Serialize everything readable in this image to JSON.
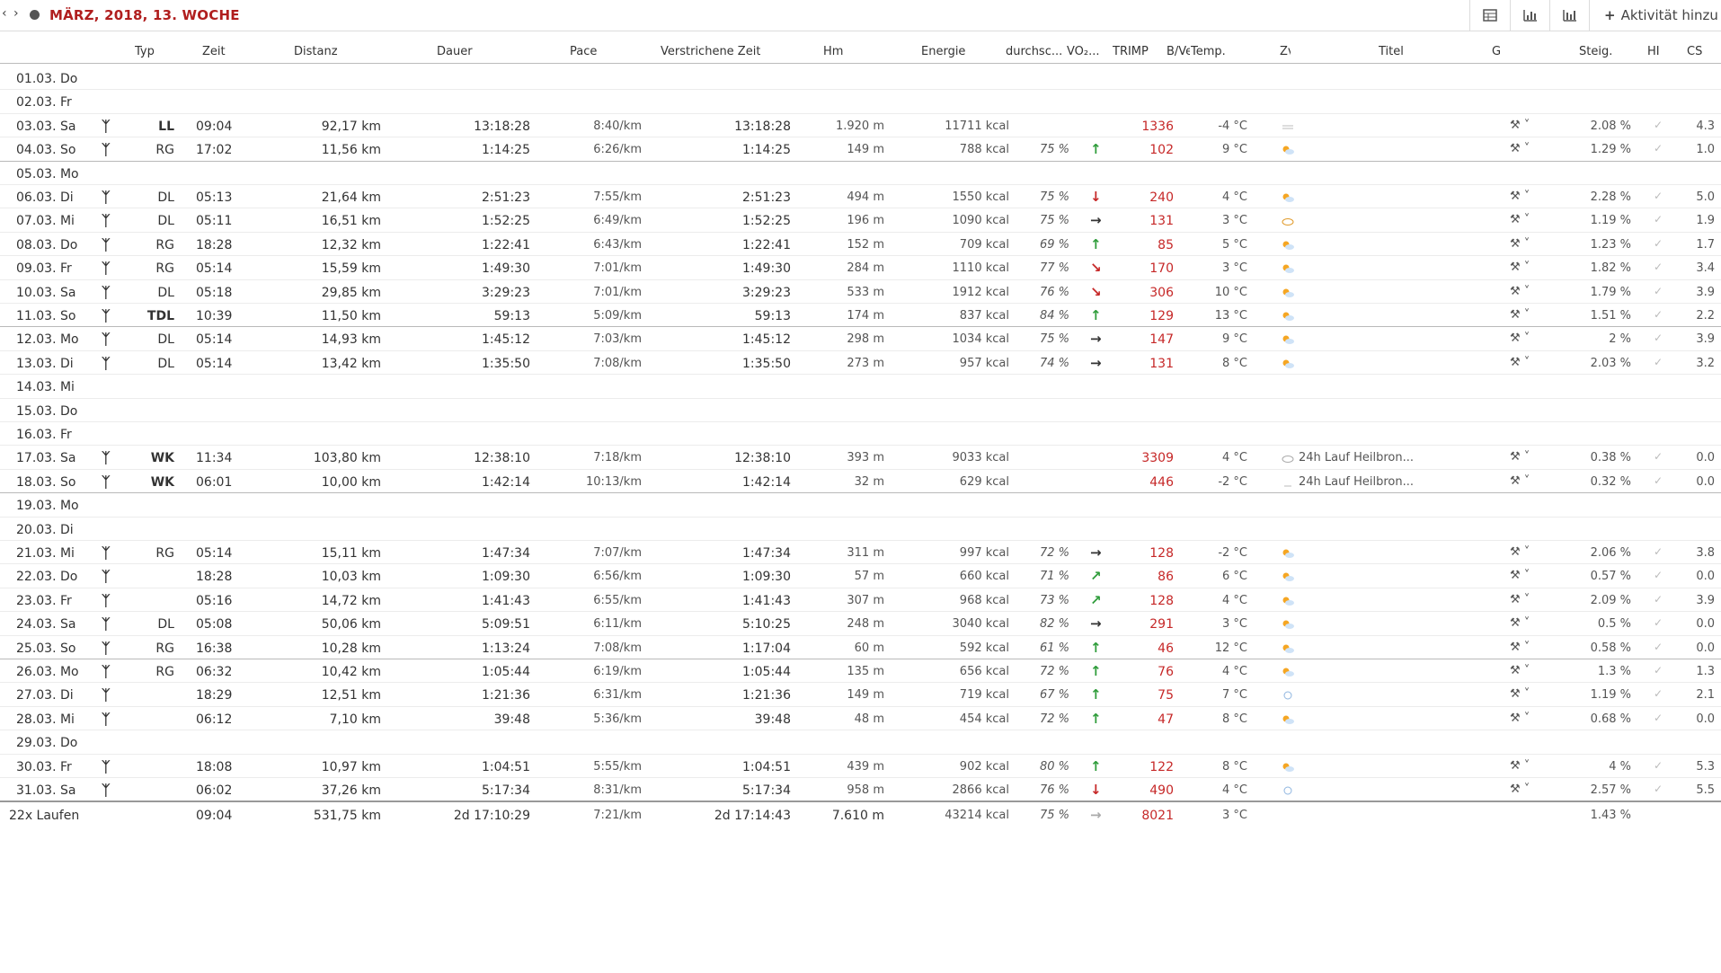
{
  "toolbar": {
    "prev": "‹",
    "next": "›",
    "week_title": "MÄRZ, 2018, 13. WOCHE",
    "add_label": "Aktivität hinzu"
  },
  "columns": {
    "typ": "Typ",
    "zeit": "Zeit",
    "distanz": "Distanz",
    "dauer": "Dauer",
    "pace": "Pace",
    "verstrichen": "Verstrichene Zeit",
    "hm": "Hm",
    "energie": "Energie",
    "durchsc": "durchsc...",
    "vo2": "VO₂...",
    "trimp": "TRIMP",
    "bv": "B/Ve",
    "temp": "Temp.",
    "zv": "Zv",
    "titel": "Titel",
    "g": "G",
    "steig": "Steig.",
    "hi": "HI",
    "cs": "CS"
  },
  "rows": [
    {
      "date": "01.03. Do",
      "act": false
    },
    {
      "date": "02.03. Fr",
      "act": false
    },
    {
      "date": "03.03. Sa",
      "act": true,
      "typ": "LL",
      "typ_bold": true,
      "zeit": "09:04",
      "dist": "92,17 km",
      "dauer": "13:18:28",
      "pace": "8:40/km",
      "verstr": "13:18:28",
      "hm": "1.920 m",
      "energie": "11711 kcal",
      "pct": "",
      "vo2": "",
      "trimp": "1336",
      "temp": "-4 °C",
      "wx": "fog",
      "titel": "",
      "steig": "2.08 %",
      "cs": "4.3"
    },
    {
      "date": "04.03. So",
      "act": true,
      "typ": "RG",
      "zeit": "17:02",
      "dist": "11,56 km",
      "dauer": "1:14:25",
      "pace": "6:26/km",
      "verstr": "1:14:25",
      "hm": "149 m",
      "energie": "788 kcal",
      "pct": "75 %",
      "vo2": "up",
      "trimp": "102",
      "temp": "9 °C",
      "wx": "sun",
      "titel": "",
      "steig": "1.29 %",
      "cs": "1.0",
      "week_end": true
    },
    {
      "date": "05.03. Mo",
      "act": false
    },
    {
      "date": "06.03. Di",
      "act": true,
      "typ": "DL",
      "zeit": "05:13",
      "dist": "21,64 km",
      "dauer": "2:51:23",
      "pace": "7:55/km",
      "verstr": "2:51:23",
      "hm": "494 m",
      "energie": "1550 kcal",
      "pct": "75 %",
      "vo2": "down",
      "trimp": "240",
      "temp": "4 °C",
      "wx": "sun",
      "titel": "",
      "steig": "2.28 %",
      "cs": "5.0"
    },
    {
      "date": "07.03. Mi",
      "act": true,
      "typ": "DL",
      "zeit": "05:11",
      "dist": "16,51 km",
      "dauer": "1:52:25",
      "pace": "6:49/km",
      "verstr": "1:52:25",
      "hm": "196 m",
      "energie": "1090 kcal",
      "pct": "75 %",
      "vo2": "right",
      "trimp": "131",
      "temp": "3 °C",
      "wx": "cloud",
      "titel": "",
      "steig": "1.19 %",
      "cs": "1.9"
    },
    {
      "date": "08.03. Do",
      "act": true,
      "typ": "RG",
      "zeit": "18:28",
      "dist": "12,32 km",
      "dauer": "1:22:41",
      "pace": "6:43/km",
      "verstr": "1:22:41",
      "hm": "152 m",
      "energie": "709 kcal",
      "pct": "69 %",
      "vo2": "up",
      "trimp": "85",
      "temp": "5 °C",
      "wx": "sun",
      "titel": "",
      "steig": "1.23 %",
      "cs": "1.7"
    },
    {
      "date": "09.03. Fr",
      "act": true,
      "typ": "RG",
      "zeit": "05:14",
      "dist": "15,59 km",
      "dauer": "1:49:30",
      "pace": "7:01/km",
      "verstr": "1:49:30",
      "hm": "284 m",
      "energie": "1110 kcal",
      "pct": "77 %",
      "vo2": "dr",
      "trimp": "170",
      "temp": "3 °C",
      "wx": "sun",
      "titel": "",
      "steig": "1.82 %",
      "cs": "3.4"
    },
    {
      "date": "10.03. Sa",
      "act": true,
      "typ": "DL",
      "zeit": "05:18",
      "dist": "29,85 km",
      "dauer": "3:29:23",
      "pace": "7:01/km",
      "verstr": "3:29:23",
      "hm": "533 m",
      "energie": "1912 kcal",
      "pct": "76 %",
      "vo2": "dr",
      "trimp": "306",
      "temp": "10 °C",
      "wx": "sun",
      "titel": "",
      "steig": "1.79 %",
      "cs": "3.9"
    },
    {
      "date": "11.03. So",
      "act": true,
      "typ": "TDL",
      "typ_bold": true,
      "zeit": "10:39",
      "dist": "11,50 km",
      "dauer": "59:13",
      "pace": "5:09/km",
      "verstr": "59:13",
      "hm": "174 m",
      "energie": "837 kcal",
      "pct": "84 %",
      "vo2": "up",
      "trimp": "129",
      "temp": "13 °C",
      "wx": "sun",
      "titel": "",
      "steig": "1.51 %",
      "cs": "2.2",
      "week_end": true
    },
    {
      "date": "12.03. Mo",
      "act": true,
      "typ": "DL",
      "zeit": "05:14",
      "dist": "14,93 km",
      "dauer": "1:45:12",
      "pace": "7:03/km",
      "verstr": "1:45:12",
      "hm": "298 m",
      "energie": "1034 kcal",
      "pct": "75 %",
      "vo2": "right",
      "trimp": "147",
      "temp": "9 °C",
      "wx": "sun",
      "titel": "",
      "steig": "2 %",
      "cs": "3.9"
    },
    {
      "date": "13.03. Di",
      "act": true,
      "typ": "DL",
      "zeit": "05:14",
      "dist": "13,42 km",
      "dauer": "1:35:50",
      "pace": "7:08/km",
      "verstr": "1:35:50",
      "hm": "273 m",
      "energie": "957 kcal",
      "pct": "74 %",
      "vo2": "right",
      "trimp": "131",
      "temp": "8 °C",
      "wx": "sun",
      "titel": "",
      "steig": "2.03 %",
      "cs": "3.2"
    },
    {
      "date": "14.03. Mi",
      "act": false
    },
    {
      "date": "15.03. Do",
      "act": false
    },
    {
      "date": "16.03. Fr",
      "act": false
    },
    {
      "date": "17.03. Sa",
      "act": true,
      "typ": "WK",
      "typ_bold": true,
      "zeit": "11:34",
      "dist": "103,80 km",
      "dauer": "12:38:10",
      "pace": "7:18/km",
      "verstr": "12:38:10",
      "hm": "393 m",
      "energie": "9033 kcal",
      "pct": "",
      "vo2": "",
      "trimp": "3309",
      "temp": "4 °C",
      "wx": "cloudgray",
      "titel": "24h Lauf Heilbron...",
      "steig": "0.38 %",
      "cs": "0.0"
    },
    {
      "date": "18.03. So",
      "act": true,
      "typ": "WK",
      "typ_bold": true,
      "zeit": "06:01",
      "dist": "10,00 km",
      "dauer": "1:42:14",
      "pace": "10:13/km",
      "verstr": "1:42:14",
      "hm": "32 m",
      "energie": "629 kcal",
      "pct": "",
      "vo2": "",
      "trimp": "446",
      "temp": "-2 °C",
      "wx": "dash",
      "titel": "24h Lauf Heilbron...",
      "steig": "0.32 %",
      "cs": "0.0",
      "week_end": true
    },
    {
      "date": "19.03. Mo",
      "act": false
    },
    {
      "date": "20.03. Di",
      "act": false
    },
    {
      "date": "21.03. Mi",
      "act": true,
      "typ": "RG",
      "zeit": "05:14",
      "dist": "15,11 km",
      "dauer": "1:47:34",
      "pace": "7:07/km",
      "verstr": "1:47:34",
      "hm": "311 m",
      "energie": "997 kcal",
      "pct": "72 %",
      "vo2": "right",
      "trimp": "128",
      "temp": "-2 °C",
      "wx": "sun",
      "titel": "",
      "steig": "2.06 %",
      "cs": "3.8"
    },
    {
      "date": "22.03. Do",
      "act": true,
      "typ": "",
      "zeit": "18:28",
      "dist": "10,03 km",
      "dauer": "1:09:30",
      "pace": "6:56/km",
      "verstr": "1:09:30",
      "hm": "57 m",
      "energie": "660 kcal",
      "pct": "71 %",
      "vo2": "ur",
      "trimp": "86",
      "temp": "6 °C",
      "wx": "sun",
      "titel": "",
      "steig": "0.57 %",
      "cs": "0.0"
    },
    {
      "date": "23.03. Fr",
      "act": true,
      "typ": "",
      "zeit": "05:16",
      "dist": "14,72 km",
      "dauer": "1:41:43",
      "pace": "6:55/km",
      "verstr": "1:41:43",
      "hm": "307 m",
      "energie": "968 kcal",
      "pct": "73 %",
      "vo2": "ur",
      "trimp": "128",
      "temp": "4 °C",
      "wx": "sun",
      "titel": "",
      "steig": "2.09 %",
      "cs": "3.9"
    },
    {
      "date": "24.03. Sa",
      "act": true,
      "typ": "DL",
      "zeit": "05:08",
      "dist": "50,06 km",
      "dauer": "5:09:51",
      "pace": "6:11/km",
      "verstr": "5:10:25",
      "hm": "248 m",
      "energie": "3040 kcal",
      "pct": "82 %",
      "vo2": "right",
      "trimp": "291",
      "temp": "3 °C",
      "wx": "sun",
      "titel": "",
      "steig": "0.5 %",
      "cs": "0.0"
    },
    {
      "date": "25.03. So",
      "act": true,
      "typ": "RG",
      "zeit": "16:38",
      "dist": "10,28 km",
      "dauer": "1:13:24",
      "pace": "7:08/km",
      "verstr": "1:17:04",
      "hm": "60 m",
      "energie": "592 kcal",
      "pct": "61 %",
      "vo2": "up",
      "trimp": "46",
      "temp": "12 °C",
      "wx": "sun",
      "titel": "",
      "steig": "0.58 %",
      "cs": "0.0",
      "week_end": true
    },
    {
      "date": "26.03. Mo",
      "act": true,
      "typ": "RG",
      "zeit": "06:32",
      "dist": "10,42 km",
      "dauer": "1:05:44",
      "pace": "6:19/km",
      "verstr": "1:05:44",
      "hm": "135 m",
      "energie": "656 kcal",
      "pct": "72 %",
      "vo2": "up",
      "trimp": "76",
      "temp": "4 °C",
      "wx": "sun",
      "titel": "",
      "steig": "1.3 %",
      "cs": "1.3"
    },
    {
      "date": "27.03. Di",
      "act": true,
      "typ": "",
      "zeit": "18:29",
      "dist": "12,51 km",
      "dauer": "1:21:36",
      "pace": "6:31/km",
      "verstr": "1:21:36",
      "hm": "149 m",
      "energie": "719 kcal",
      "pct": "67 %",
      "vo2": "up",
      "trimp": "75",
      "temp": "7 °C",
      "wx": "moon",
      "titel": "",
      "steig": "1.19 %",
      "cs": "2.1"
    },
    {
      "date": "28.03. Mi",
      "act": true,
      "typ": "",
      "zeit": "06:12",
      "dist": "7,10 km",
      "dauer": "39:48",
      "pace": "5:36/km",
      "verstr": "39:48",
      "hm": "48 m",
      "energie": "454 kcal",
      "pct": "72 %",
      "vo2": "up",
      "trimp": "47",
      "temp": "8 °C",
      "wx": "sun",
      "titel": "",
      "steig": "0.68 %",
      "cs": "0.0"
    },
    {
      "date": "29.03. Do",
      "act": false
    },
    {
      "date": "30.03. Fr",
      "act": true,
      "typ": "",
      "zeit": "18:08",
      "dist": "10,97 km",
      "dauer": "1:04:51",
      "pace": "5:55/km",
      "verstr": "1:04:51",
      "hm": "439 m",
      "energie": "902 kcal",
      "pct": "80 %",
      "vo2": "up",
      "trimp": "122",
      "temp": "8 °C",
      "wx": "sun",
      "titel": "",
      "steig": "4 %",
      "cs": "5.3"
    },
    {
      "date": "31.03. Sa",
      "act": true,
      "typ": "",
      "zeit": "06:02",
      "dist": "37,26 km",
      "dauer": "5:17:34",
      "pace": "8:31/km",
      "verstr": "5:17:34",
      "hm": "958 m",
      "energie": "2866 kcal",
      "pct": "76 %",
      "vo2": "down",
      "trimp": "490",
      "temp": "4 °C",
      "wx": "moon",
      "titel": "",
      "steig": "2.57 %",
      "cs": "5.5"
    }
  ],
  "total": {
    "label": "22x Laufen",
    "zeit": "09:04",
    "dist": "531,75 km",
    "dauer": "2d 17:10:29",
    "pace": "7:21/km",
    "verstr": "2d 17:14:43",
    "hm": "7.610 m",
    "energie": "43214 kcal",
    "pct": "75 %",
    "vo2": "right",
    "trimp": "8021",
    "temp": "3 °C",
    "steig": "1.43 %"
  },
  "colors": {
    "accent": "#b01e1e",
    "trimp": "#c62828",
    "up": "#2e9c3a",
    "down": "#c62828"
  }
}
